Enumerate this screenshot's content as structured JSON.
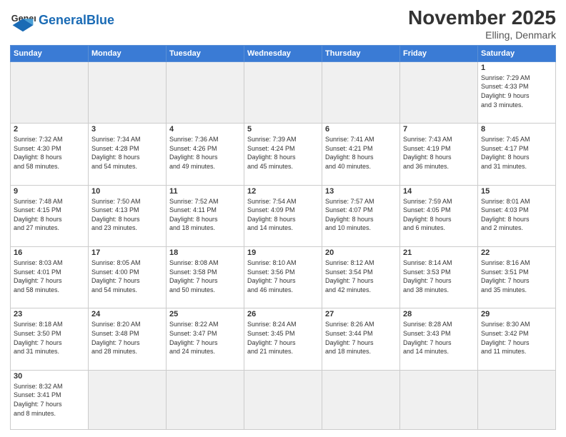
{
  "header": {
    "logo_general": "General",
    "logo_blue": "Blue",
    "month_title": "November 2025",
    "subtitle": "Elling, Denmark"
  },
  "weekdays": [
    "Sunday",
    "Monday",
    "Tuesday",
    "Wednesday",
    "Thursday",
    "Friday",
    "Saturday"
  ],
  "weeks": [
    [
      {
        "day": "",
        "info": "",
        "empty": true
      },
      {
        "day": "",
        "info": "",
        "empty": true
      },
      {
        "day": "",
        "info": "",
        "empty": true
      },
      {
        "day": "",
        "info": "",
        "empty": true
      },
      {
        "day": "",
        "info": "",
        "empty": true
      },
      {
        "day": "",
        "info": "",
        "empty": true
      },
      {
        "day": "1",
        "info": "Sunrise: 7:29 AM\nSunset: 4:33 PM\nDaylight: 9 hours\nand 3 minutes.",
        "empty": false
      }
    ],
    [
      {
        "day": "2",
        "info": "Sunrise: 7:32 AM\nSunset: 4:30 PM\nDaylight: 8 hours\nand 58 minutes.",
        "empty": false
      },
      {
        "day": "3",
        "info": "Sunrise: 7:34 AM\nSunset: 4:28 PM\nDaylight: 8 hours\nand 54 minutes.",
        "empty": false
      },
      {
        "day": "4",
        "info": "Sunrise: 7:36 AM\nSunset: 4:26 PM\nDaylight: 8 hours\nand 49 minutes.",
        "empty": false
      },
      {
        "day": "5",
        "info": "Sunrise: 7:39 AM\nSunset: 4:24 PM\nDaylight: 8 hours\nand 45 minutes.",
        "empty": false
      },
      {
        "day": "6",
        "info": "Sunrise: 7:41 AM\nSunset: 4:21 PM\nDaylight: 8 hours\nand 40 minutes.",
        "empty": false
      },
      {
        "day": "7",
        "info": "Sunrise: 7:43 AM\nSunset: 4:19 PM\nDaylight: 8 hours\nand 36 minutes.",
        "empty": false
      },
      {
        "day": "8",
        "info": "Sunrise: 7:45 AM\nSunset: 4:17 PM\nDaylight: 8 hours\nand 31 minutes.",
        "empty": false
      }
    ],
    [
      {
        "day": "9",
        "info": "Sunrise: 7:48 AM\nSunset: 4:15 PM\nDaylight: 8 hours\nand 27 minutes.",
        "empty": false
      },
      {
        "day": "10",
        "info": "Sunrise: 7:50 AM\nSunset: 4:13 PM\nDaylight: 8 hours\nand 23 minutes.",
        "empty": false
      },
      {
        "day": "11",
        "info": "Sunrise: 7:52 AM\nSunset: 4:11 PM\nDaylight: 8 hours\nand 18 minutes.",
        "empty": false
      },
      {
        "day": "12",
        "info": "Sunrise: 7:54 AM\nSunset: 4:09 PM\nDaylight: 8 hours\nand 14 minutes.",
        "empty": false
      },
      {
        "day": "13",
        "info": "Sunrise: 7:57 AM\nSunset: 4:07 PM\nDaylight: 8 hours\nand 10 minutes.",
        "empty": false
      },
      {
        "day": "14",
        "info": "Sunrise: 7:59 AM\nSunset: 4:05 PM\nDaylight: 8 hours\nand 6 minutes.",
        "empty": false
      },
      {
        "day": "15",
        "info": "Sunrise: 8:01 AM\nSunset: 4:03 PM\nDaylight: 8 hours\nand 2 minutes.",
        "empty": false
      }
    ],
    [
      {
        "day": "16",
        "info": "Sunrise: 8:03 AM\nSunset: 4:01 PM\nDaylight: 7 hours\nand 58 minutes.",
        "empty": false
      },
      {
        "day": "17",
        "info": "Sunrise: 8:05 AM\nSunset: 4:00 PM\nDaylight: 7 hours\nand 54 minutes.",
        "empty": false
      },
      {
        "day": "18",
        "info": "Sunrise: 8:08 AM\nSunset: 3:58 PM\nDaylight: 7 hours\nand 50 minutes.",
        "empty": false
      },
      {
        "day": "19",
        "info": "Sunrise: 8:10 AM\nSunset: 3:56 PM\nDaylight: 7 hours\nand 46 minutes.",
        "empty": false
      },
      {
        "day": "20",
        "info": "Sunrise: 8:12 AM\nSunset: 3:54 PM\nDaylight: 7 hours\nand 42 minutes.",
        "empty": false
      },
      {
        "day": "21",
        "info": "Sunrise: 8:14 AM\nSunset: 3:53 PM\nDaylight: 7 hours\nand 38 minutes.",
        "empty": false
      },
      {
        "day": "22",
        "info": "Sunrise: 8:16 AM\nSunset: 3:51 PM\nDaylight: 7 hours\nand 35 minutes.",
        "empty": false
      }
    ],
    [
      {
        "day": "23",
        "info": "Sunrise: 8:18 AM\nSunset: 3:50 PM\nDaylight: 7 hours\nand 31 minutes.",
        "empty": false
      },
      {
        "day": "24",
        "info": "Sunrise: 8:20 AM\nSunset: 3:48 PM\nDaylight: 7 hours\nand 28 minutes.",
        "empty": false
      },
      {
        "day": "25",
        "info": "Sunrise: 8:22 AM\nSunset: 3:47 PM\nDaylight: 7 hours\nand 24 minutes.",
        "empty": false
      },
      {
        "day": "26",
        "info": "Sunrise: 8:24 AM\nSunset: 3:45 PM\nDaylight: 7 hours\nand 21 minutes.",
        "empty": false
      },
      {
        "day": "27",
        "info": "Sunrise: 8:26 AM\nSunset: 3:44 PM\nDaylight: 7 hours\nand 18 minutes.",
        "empty": false
      },
      {
        "day": "28",
        "info": "Sunrise: 8:28 AM\nSunset: 3:43 PM\nDaylight: 7 hours\nand 14 minutes.",
        "empty": false
      },
      {
        "day": "29",
        "info": "Sunrise: 8:30 AM\nSunset: 3:42 PM\nDaylight: 7 hours\nand 11 minutes.",
        "empty": false
      }
    ],
    [
      {
        "day": "30",
        "info": "Sunrise: 8:32 AM\nSunset: 3:41 PM\nDaylight: 7 hours\nand 8 minutes.",
        "empty": false
      },
      {
        "day": "",
        "info": "",
        "empty": true
      },
      {
        "day": "",
        "info": "",
        "empty": true
      },
      {
        "day": "",
        "info": "",
        "empty": true
      },
      {
        "day": "",
        "info": "",
        "empty": true
      },
      {
        "day": "",
        "info": "",
        "empty": true
      },
      {
        "day": "",
        "info": "",
        "empty": true
      }
    ]
  ]
}
